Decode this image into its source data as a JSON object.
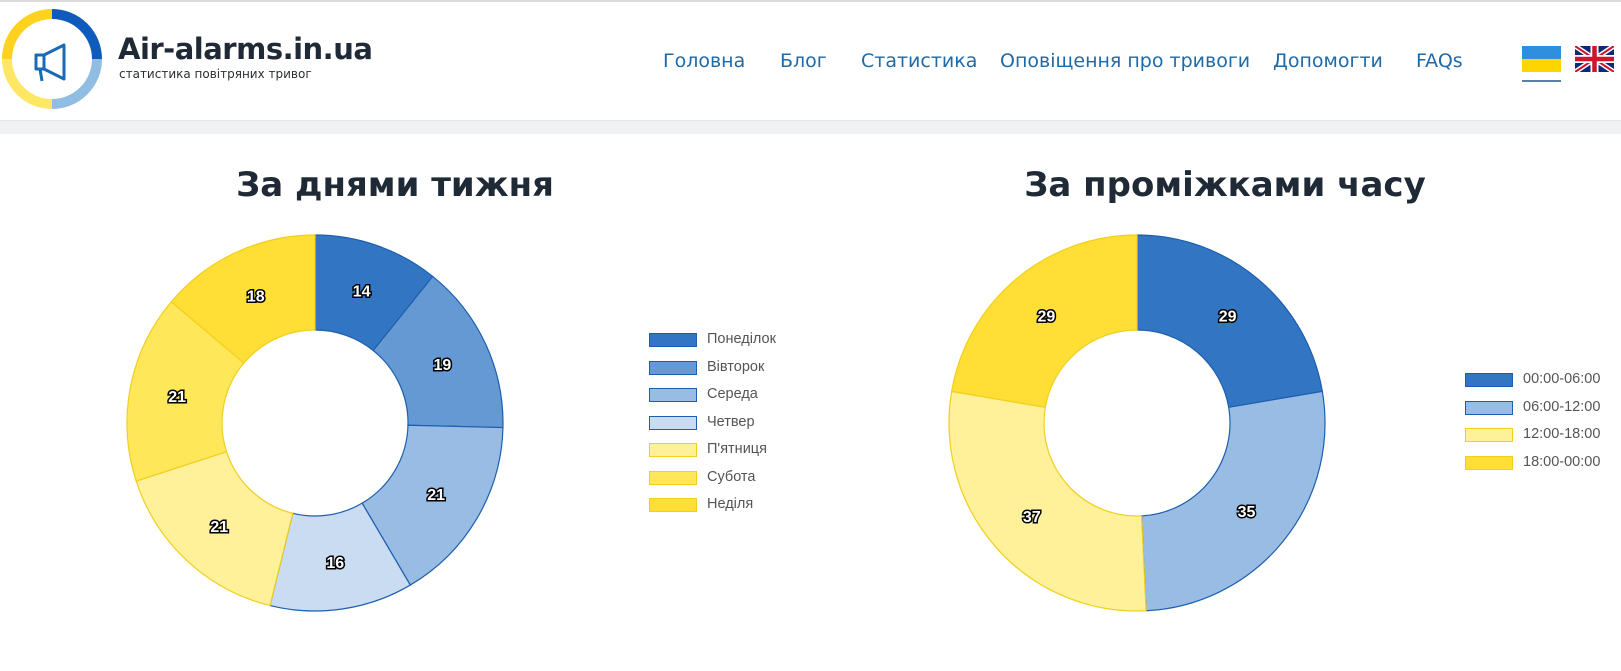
{
  "header": {
    "logo_icon": "megaphone-icon",
    "site_title": "Air-alarms.in.ua",
    "site_subtitle": "статистика повітряних тривог",
    "nav": [
      {
        "label": "Головна",
        "name": "nav-home"
      },
      {
        "label": "Блог",
        "name": "nav-blog"
      },
      {
        "label": "Статистика",
        "name": "nav-statistics"
      },
      {
        "label": "Оповіщення про тривоги",
        "name": "nav-alerts"
      },
      {
        "label": "Допомогти",
        "name": "nav-help"
      },
      {
        "label": "FAQs",
        "name": "nav-faqs"
      }
    ],
    "language_flags": [
      {
        "icon": "ukraine-flag-icon",
        "selected": true
      },
      {
        "icon": "uk-flag-icon",
        "selected": false
      }
    ],
    "colors": {
      "brand_blue": "#0e5bbd",
      "brand_yellow": "#ffd500",
      "nav_link": "#1e6aa8"
    }
  },
  "chart_data": [
    {
      "type": "pie",
      "variant": "doughnut",
      "title": "За днями тижня",
      "legend_position": "right",
      "categories": [
        "Понеділок",
        "Вівторок",
        "Середа",
        "Четвер",
        "П'ятниця",
        "Субота",
        "Неділя"
      ],
      "values": [
        14,
        19,
        21,
        16,
        21,
        21,
        18
      ],
      "colors": [
        "#3276c3",
        "#6499d3",
        "#99bce4",
        "#c9dcf1",
        "#fff09a",
        "#ffe75a",
        "#ffde35"
      ]
    },
    {
      "type": "pie",
      "variant": "doughnut",
      "title": "За проміжками часу",
      "legend_position": "right",
      "categories": [
        "00:00-06:00",
        "06:00-12:00",
        "12:00-18:00",
        "18:00-00:00"
      ],
      "values": [
        29,
        35,
        37,
        29
      ],
      "colors": [
        "#3276c3",
        "#99bce4",
        "#fff09a",
        "#ffde35"
      ]
    }
  ]
}
